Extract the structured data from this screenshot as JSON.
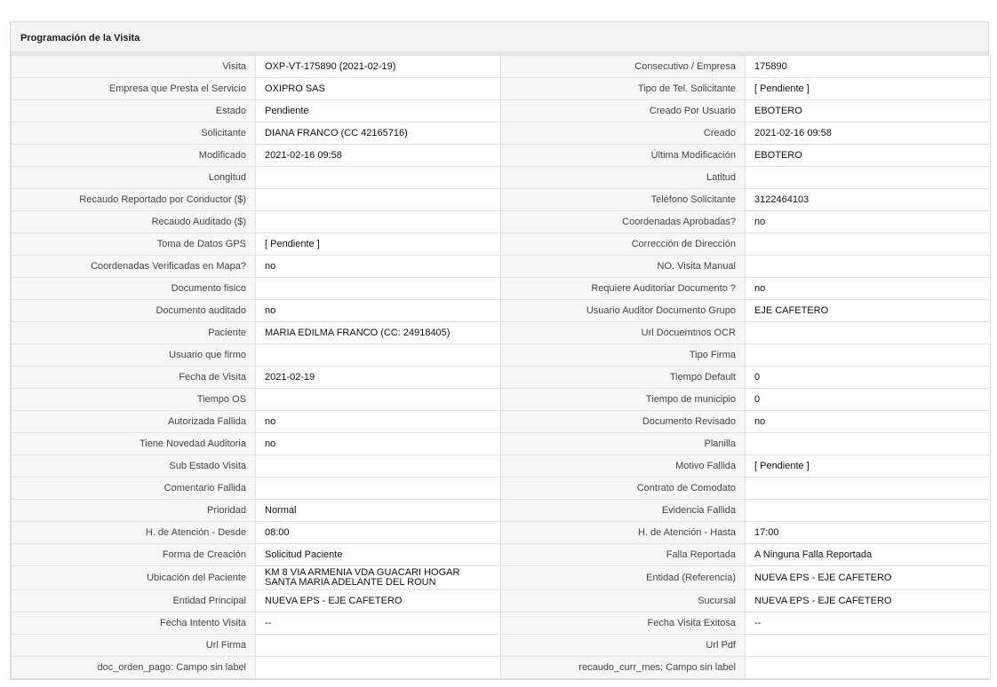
{
  "panel": {
    "title": "Programación de la Visita"
  },
  "rows": [
    [
      {
        "label": "Visita",
        "value": "OXP-VT-175890 (2021-02-19)"
      },
      {
        "label": "Consecutivo / Empresa",
        "value": "175890"
      }
    ],
    [
      {
        "label": "Empresa que Presta el Servicio",
        "value": "OXIPRO SAS"
      },
      {
        "label": "Tipo de Tel. Solicitante",
        "value": "[ Pendiente ]"
      }
    ],
    [
      {
        "label": "Estado",
        "value": "Pendiente"
      },
      {
        "label": "Creado Por Usuario",
        "value": "EBOTERO"
      }
    ],
    [
      {
        "label": "Solicitante",
        "value": "DIANA FRANCO (CC 42165716)"
      },
      {
        "label": "Creado",
        "value": "2021-02-16 09:58"
      }
    ],
    [
      {
        "label": "Modificado",
        "value": "2021-02-16 09:58"
      },
      {
        "label": "Última Modificación",
        "value": " EBOTERO"
      }
    ],
    [
      {
        "label": "Longitud",
        "value": ""
      },
      {
        "label": "Latitud",
        "value": ""
      }
    ],
    [
      {
        "label": "Recaudo Reportado por Conductor ($)",
        "value": ""
      },
      {
        "label": "Teléfono Solicitante",
        "value": "3122464103"
      }
    ],
    [
      {
        "label": "Recaudo Auditado ($)",
        "value": ""
      },
      {
        "label": "Coordenadas Aprobadas?",
        "value": " no"
      }
    ],
    [
      {
        "label": "Toma de Datos GPS",
        "value": "[ Pendiente ]"
      },
      {
        "label": "Corrección de Dirección",
        "value": ""
      }
    ],
    [
      {
        "label": "Coordenadas Verificadas en Mapa?",
        "value": " no"
      },
      {
        "label": "NO. Visita Manual",
        "value": ""
      }
    ],
    [
      {
        "label": "Documento fisico",
        "value": ""
      },
      {
        "label": "Requiere Auditoriar Documento ?",
        "value": " no"
      }
    ],
    [
      {
        "label": "Documento auditado",
        "value": " no"
      },
      {
        "label": "Usuario Auditor Documento Grupo",
        "value": "EJE CAFETERO"
      }
    ],
    [
      {
        "label": "Paciente",
        "value": "MARIA EDILMA FRANCO (CC: 24918405)"
      },
      {
        "label": "Url Docuemtnos OCR",
        "value": ""
      }
    ],
    [
      {
        "label": "Usuario que firmo",
        "value": ""
      },
      {
        "label": "Tipo Firma",
        "value": ""
      }
    ],
    [
      {
        "label": "Fecha de Visita",
        "value": " 2021-02-19"
      },
      {
        "label": "Tiempo Default",
        "value": " 0"
      }
    ],
    [
      {
        "label": "Tiempo OS",
        "value": ""
      },
      {
        "label": "Tiempo de municipio",
        "value": " 0"
      }
    ],
    [
      {
        "label": "Autorizada Fallida",
        "value": " no"
      },
      {
        "label": "Documento Revisado",
        "value": " no"
      }
    ],
    [
      {
        "label": "Tiene Novedad Auditoria",
        "value": " no"
      },
      {
        "label": "Planilla",
        "value": ""
      }
    ],
    [
      {
        "label": "Sub Estado Visita",
        "value": ""
      },
      {
        "label": "Motivo Fallida",
        "value": "[ Pendiente ]"
      }
    ],
    [
      {
        "label": "Comentario Fallida",
        "value": ""
      },
      {
        "label": "Contrato de Comodato",
        "value": ""
      }
    ],
    [
      {
        "label": "Prioridad",
        "value": "Normal"
      },
      {
        "label": "Evidencia Fallida",
        "value": ""
      }
    ],
    [
      {
        "label": "H. de Atención - Desde",
        "value": "08:00"
      },
      {
        "label": "H. de Atención - Hasta",
        "value": "17:00"
      }
    ],
    [
      {
        "label": "Forma de Creación",
        "value": "Solicitud Paciente"
      },
      {
        "label": "Falla Reportada",
        "value": "A Ninguna Falla Reportada"
      }
    ],
    [
      {
        "label": "Ubicación del Paciente",
        "value": "KM 8 VIA ARMENIA VDA GUACARI HOGAR SANTA MARIA ADELANTE DEL ROUN"
      },
      {
        "label": "Entidad (Referencia)",
        "value": "NUEVA EPS - EJE CAFETERO"
      }
    ],
    [
      {
        "label": "Entidad Principal",
        "value": "NUEVA EPS - EJE CAFETERO"
      },
      {
        "label": "Sucursal",
        "value": "NUEVA EPS - EJE CAFETERO"
      }
    ],
    [
      {
        "label": "Fecha Intento Visita",
        "value": "--"
      },
      {
        "label": "Fecha Visita Exitosa",
        "value": "--"
      }
    ],
    [
      {
        "label": "Url Firma",
        "value": ""
      },
      {
        "label": "Url Pdf",
        "value": ""
      }
    ],
    [
      {
        "label": "doc_orden_pago: Campo sin label",
        "value": ""
      },
      {
        "label": "recaudo_curr_mes: Campo sin label",
        "value": ""
      }
    ]
  ]
}
